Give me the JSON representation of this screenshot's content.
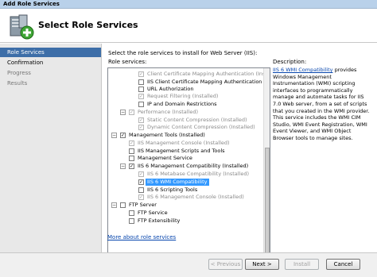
{
  "window": {
    "title": "Add Role Services"
  },
  "header": {
    "title": "Select Role Services",
    "icon": "server-add-icon"
  },
  "nav": {
    "items": [
      {
        "label": "Role Services",
        "state": "active"
      },
      {
        "label": "Confirmation",
        "state": "normal"
      },
      {
        "label": "Progress",
        "state": "muted"
      },
      {
        "label": "Results",
        "state": "muted"
      }
    ]
  },
  "main": {
    "instruction": "Select the role services to install for Web Server (IIS):",
    "role_services_label": "Role services:",
    "tree": [
      {
        "label": "Client Certificate Mapping Authentication  (Installed)",
        "checked": true,
        "disabled": true
      },
      {
        "label": "IIS Client Certificate Mapping Authentication",
        "checked": false,
        "disabled": false
      },
      {
        "label": "URL Authorization",
        "checked": false,
        "disabled": false
      },
      {
        "label": "Request Filtering  (Installed)",
        "checked": true,
        "disabled": true
      },
      {
        "label": "IP and Domain Restrictions",
        "checked": false,
        "disabled": false
      },
      {
        "label": "Performance  (Installed)",
        "checked": true,
        "disabled": true
      },
      {
        "label": "Static Content Compression  (Installed)",
        "checked": true,
        "disabled": true
      },
      {
        "label": "Dynamic Content Compression  (Installed)",
        "checked": true,
        "disabled": true
      },
      {
        "label": "Management Tools  (Installed)",
        "checked": true,
        "disabled": false
      },
      {
        "label": "IIS Management Console  (Installed)",
        "checked": true,
        "disabled": true
      },
      {
        "label": "IIS Management Scripts and Tools",
        "checked": false,
        "disabled": false
      },
      {
        "label": "Management Service",
        "checked": false,
        "disabled": false
      },
      {
        "label": "IIS 6 Management Compatibility  (Installed)",
        "checked": true,
        "disabled": false
      },
      {
        "label": "IIS 6 Metabase Compatibility  (Installed)",
        "checked": true,
        "disabled": true
      },
      {
        "label": "IIS 6 WMI Compatibility",
        "checked": true,
        "disabled": false,
        "selected": true
      },
      {
        "label": "IIS 6 Scripting Tools",
        "checked": false,
        "disabled": false
      },
      {
        "label": "IIS 6 Management Console  (Installed)",
        "checked": true,
        "disabled": true
      },
      {
        "label": "FTP Server",
        "checked": false,
        "disabled": false
      },
      {
        "label": "FTP Service",
        "checked": false,
        "disabled": false
      },
      {
        "label": "FTP Extensibility",
        "checked": false,
        "disabled": false
      }
    ],
    "more_link": "More about role services"
  },
  "description": {
    "title": "Description:",
    "link": "IIS 6 WMI Compatibility",
    "text": " provides Windows Management Instrumentation (WMI) scripting interfaces to programmatically manage and automate tasks for IIS 7.0 Web server, from a set of scripts that you created in the WMI provider. This service includes the WMI CIM Studio, WMI Event Registration, WMI Event Viewer, and WMI Object Browser tools to manage sites."
  },
  "footer": {
    "previous": "< Previous",
    "next": "Next >",
    "install": "Install",
    "cancel": "Cancel"
  }
}
